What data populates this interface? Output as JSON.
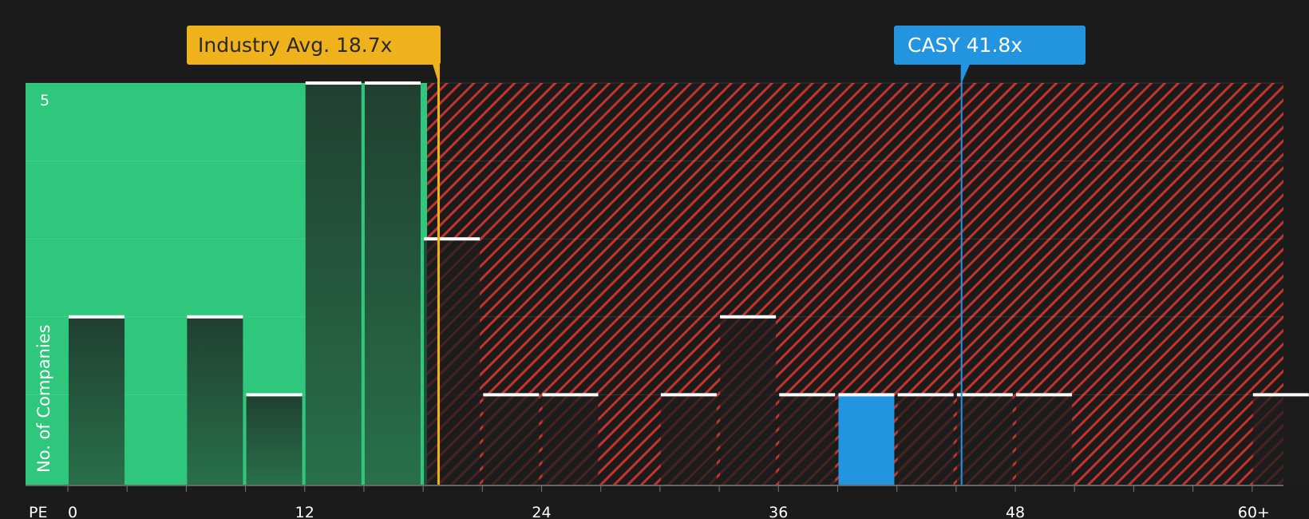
{
  "chart_data": {
    "type": "bar",
    "x_axis_label": "PE",
    "ylabel": "No. of Companies",
    "x_ticks": [
      "0",
      "12",
      "24",
      "36",
      "48",
      "60+"
    ],
    "y_ticks": [
      "5"
    ],
    "ylim": [
      0,
      5
    ],
    "bins": [
      {
        "start": 0,
        "end": 3,
        "value": 2
      },
      {
        "start": 3,
        "end": 6,
        "value": 0
      },
      {
        "start": 6,
        "end": 9,
        "value": 2
      },
      {
        "start": 9,
        "end": 12,
        "value": 1
      },
      {
        "start": 12,
        "end": 15,
        "value": 5
      },
      {
        "start": 15,
        "end": 18,
        "value": 5
      },
      {
        "start": 18,
        "end": 21,
        "value": 3
      },
      {
        "start": 21,
        "end": 24,
        "value": 1
      },
      {
        "start": 24,
        "end": 27,
        "value": 1
      },
      {
        "start": 27,
        "end": 30,
        "value": 0
      },
      {
        "start": 30,
        "end": 33,
        "value": 1
      },
      {
        "start": 33,
        "end": 36,
        "value": 2
      },
      {
        "start": 36,
        "end": 39,
        "value": 1
      },
      {
        "start": 39,
        "end": 42,
        "value": 1,
        "highlight": true
      },
      {
        "start": 42,
        "end": 45,
        "value": 1
      },
      {
        "start": 45,
        "end": 48,
        "value": 1
      },
      {
        "start": 48,
        "end": 51,
        "value": 1
      },
      {
        "start": 51,
        "end": 54,
        "value": 0
      },
      {
        "start": 54,
        "end": 57,
        "value": 0
      },
      {
        "start": 57,
        "end": 60,
        "value": 0
      },
      {
        "start": 60,
        "end": 63,
        "value": 1
      }
    ],
    "good_value_upper_pe": 18,
    "industry_avg_pe": 18.7,
    "company_pe": 41.8,
    "industry_label": "Industry Avg. 18.7x",
    "company_label": "CASY 41.8x",
    "colors": {
      "background": "#1b1b1b",
      "good_zone": "#2ec77b",
      "bad_zone_stripe": "#d6352f",
      "bar_dark_top": "#213f31",
      "bar_dark_bottom": "#28704a",
      "bar_cap": "#ffffff",
      "highlight_bar": "#2394e0",
      "industry": "#efb21c",
      "company": "#2394e0"
    }
  }
}
